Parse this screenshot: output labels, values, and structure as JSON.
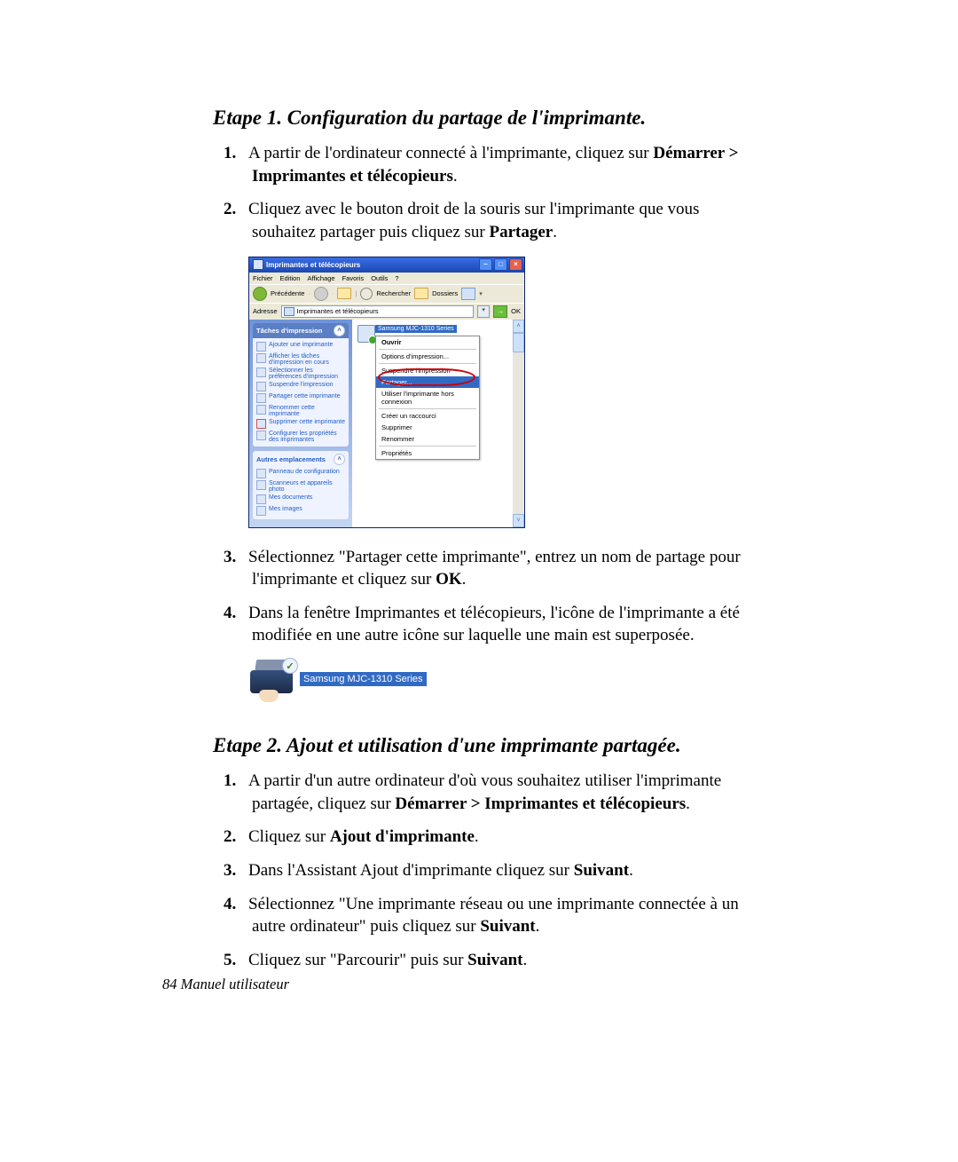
{
  "step1": {
    "title": "Etape 1. Configuration du partage de l'imprimante.",
    "items": {
      "i1a": "A partir de l'ordinateur connecté à l'imprimante, cliquez sur ",
      "i1b": "Démarrer > Imprimantes et télécopieurs",
      "i1c": ".",
      "i2a": "Cliquez avec le bouton droit de la souris sur l'imprimante que vous souhaitez partager puis cliquez sur ",
      "i2b": "Partager",
      "i2c": ".",
      "i3a": "Sélectionnez \"Partager cette imprimante\", entrez un nom de partage pour l'imprimante et cliquez sur ",
      "i3b": "OK",
      "i3c": ".",
      "i4": "Dans la fenêtre Imprimantes et télécopieurs, l'icône de l'imprimante a été modifiée en une autre icône sur laquelle une main est superposée."
    }
  },
  "step2": {
    "title": "Etape 2. Ajout et utilisation d'une imprimante partagée.",
    "items": {
      "i1a": "A partir d'un autre ordinateur d'où vous souhaitez utiliser l'imprimante partagée, cliquez sur ",
      "i1b": "Démarrer > Imprimantes et télécopieurs",
      "i1c": ".",
      "i2a": "Cliquez sur ",
      "i2b": "Ajout d'imprimante",
      "i2c": ".",
      "i3a": "Dans l'Assistant Ajout d'imprimante cliquez sur ",
      "i3b": "Suivant",
      "i3c": ".",
      "i4a": "Sélectionnez \"Une imprimante réseau ou une imprimante connectée à un autre ordinateur\" puis cliquez sur ",
      "i4b": "Suivant",
      "i4c": ".",
      "i5a": "Cliquez sur \"Parcourir\" puis sur ",
      "i5b": "Suivant",
      "i5c": "."
    }
  },
  "window": {
    "title": "Imprimantes et télécopieurs",
    "menus": [
      "Fichier",
      "Edition",
      "Affichage",
      "Favoris",
      "Outils",
      "?"
    ],
    "toolbar": {
      "back": "Précédente",
      "search": "Rechercher",
      "folders": "Dossiers"
    },
    "address": {
      "label": "Adresse",
      "value": "Imprimantes et télécopieurs",
      "ok": "OK"
    },
    "panel1": {
      "title": "Tâches d'impression",
      "items": [
        "Ajouter une imprimante",
        "Afficher les tâches d'impression en cours",
        "Sélectionner les préférences d'impression",
        "Suspendre l'impression",
        "Partager cette imprimante",
        "Renommer cette imprimante",
        "Supprimer cette imprimante",
        "Configurer les propriétés des imprimantes"
      ]
    },
    "panel2": {
      "title": "Autres emplacements",
      "items": [
        "Panneau de configuration",
        "Scanneurs et appareils photo",
        "Mes documents",
        "Mes images"
      ]
    },
    "printer": "Samsung MJC-1310 Series",
    "context": {
      "open": "Ouvrir",
      "prefs": "Options d'impression...",
      "pause": "Suspendre l'impression",
      "share": "Partager...",
      "offline": "Utiliser l'imprimante hors connexion",
      "shortcut": "Créer un raccourci",
      "delete": "Supprimer",
      "rename": "Renommer",
      "props": "Propriétés"
    }
  },
  "sharedIcon": {
    "label": "Samsung MJC-1310 Series"
  },
  "footer": "84  Manuel utilisateur"
}
